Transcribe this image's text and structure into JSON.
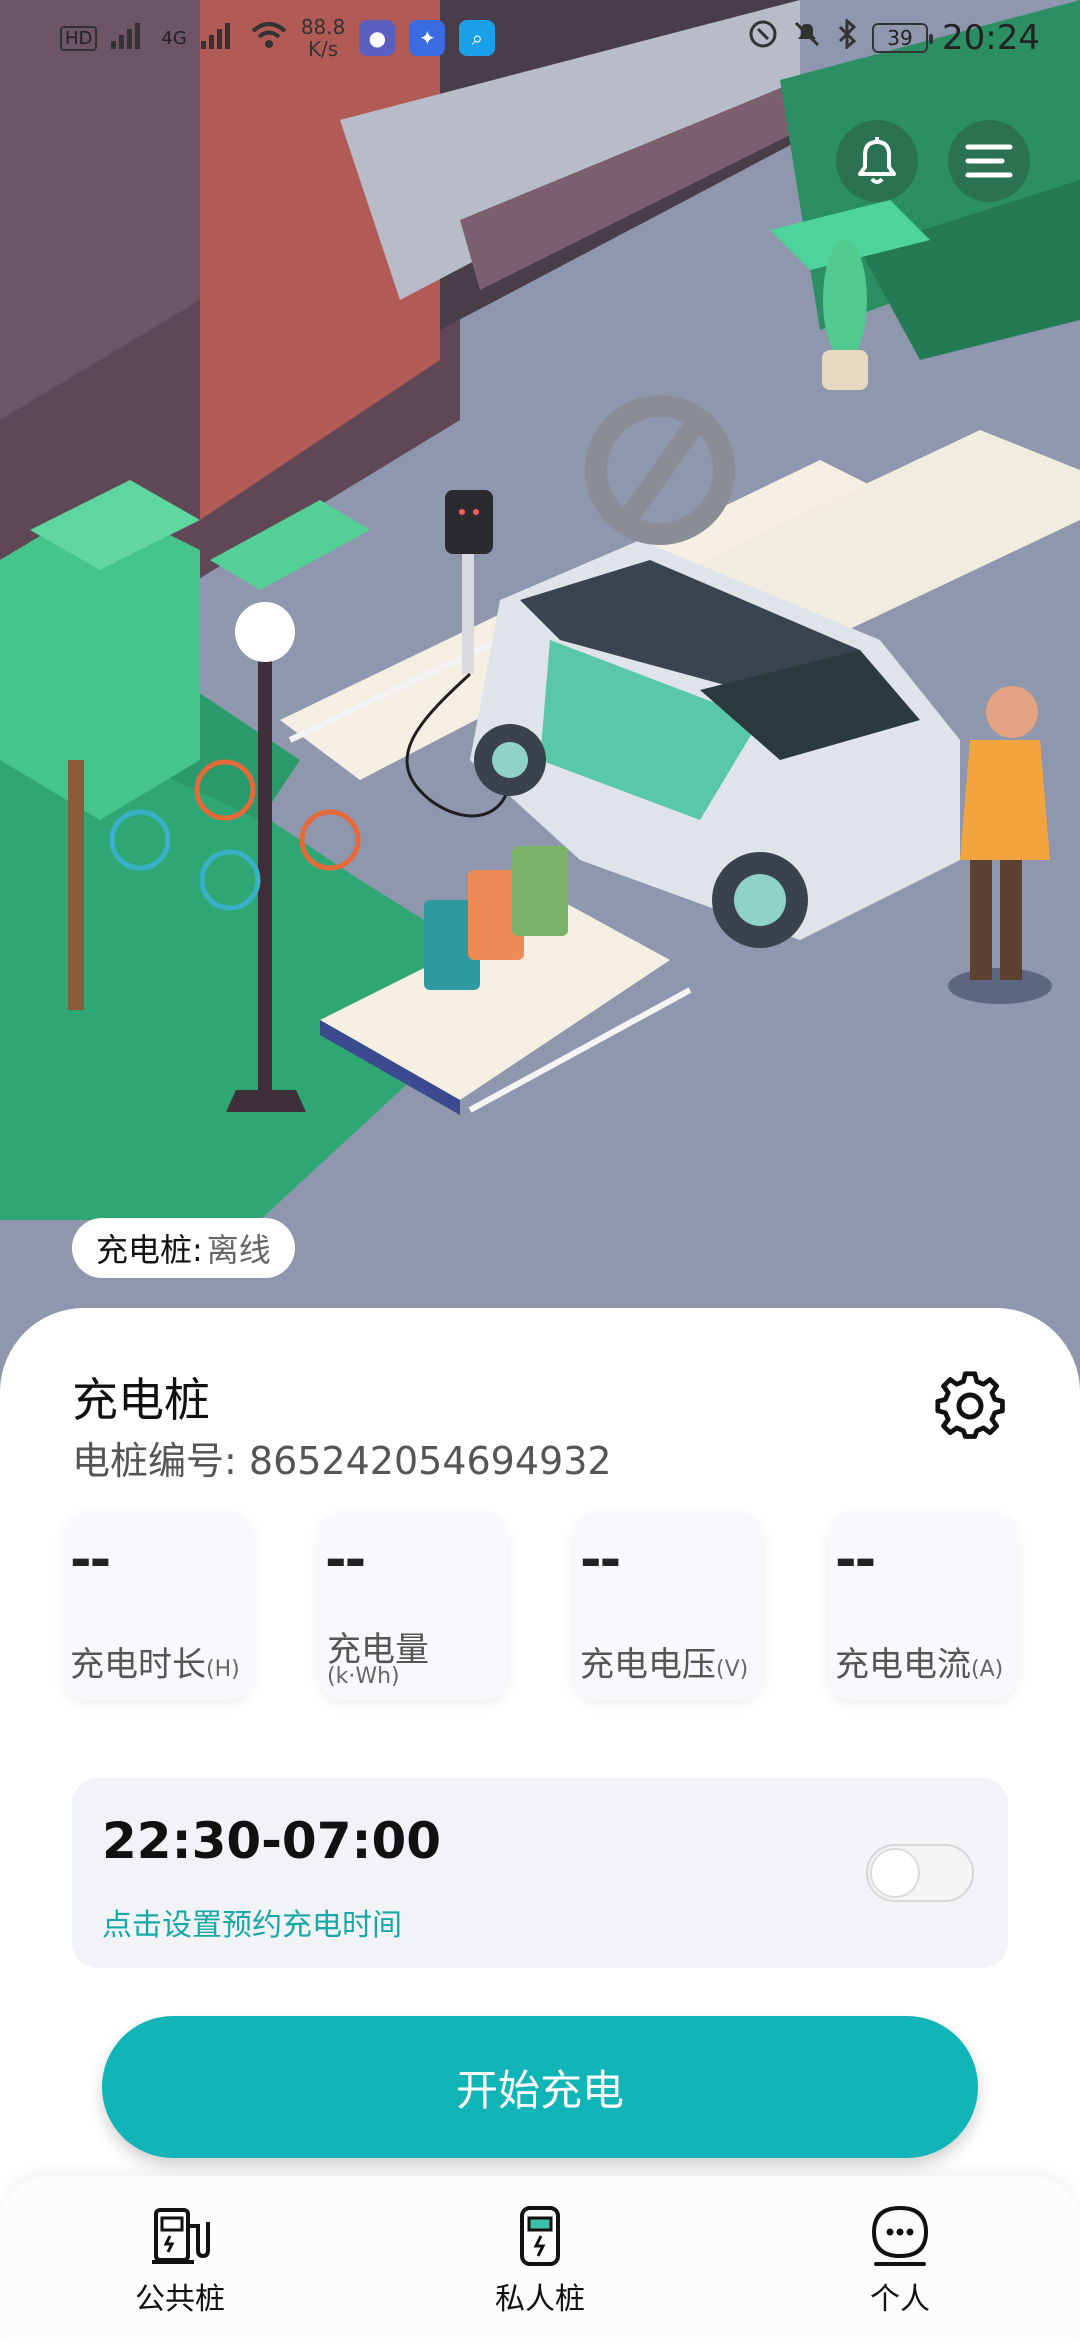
{
  "status_bar": {
    "signal_labels": [
      "HD",
      "4G"
    ],
    "speed_value": "88.8",
    "speed_unit": "K/s",
    "battery": "39",
    "time": "20:24"
  },
  "hero": {
    "status_label": "充电桩:",
    "status_value": "离线"
  },
  "card": {
    "pile_name": "充电桩",
    "pile_id_label": "电桩编号:",
    "pile_id": "865242054694932",
    "stats": [
      {
        "value": "--",
        "label": "充电时长",
        "unit": "(H)"
      },
      {
        "value": "--",
        "label": "充电量",
        "unit": "(k·Wh)"
      },
      {
        "value": "--",
        "label": "充电电压",
        "unit": "(V)"
      },
      {
        "value": "--",
        "label": "充电电流",
        "unit": "(A)"
      }
    ],
    "schedule": {
      "time_range": "22:30-07:00",
      "hint": "点击设置预约充电时间",
      "enabled": false
    },
    "start_button": "开始充电"
  },
  "nav": [
    {
      "label": "公共桩",
      "icon": "charging-station-icon"
    },
    {
      "label": "私人桩",
      "icon": "charger-device-icon"
    },
    {
      "label": "个人",
      "icon": "chat-person-icon"
    }
  ],
  "colors": {
    "accent": "#11b5b8",
    "hint": "#17a9a8",
    "road": "#8e97ad",
    "grass": "#2ea774"
  }
}
